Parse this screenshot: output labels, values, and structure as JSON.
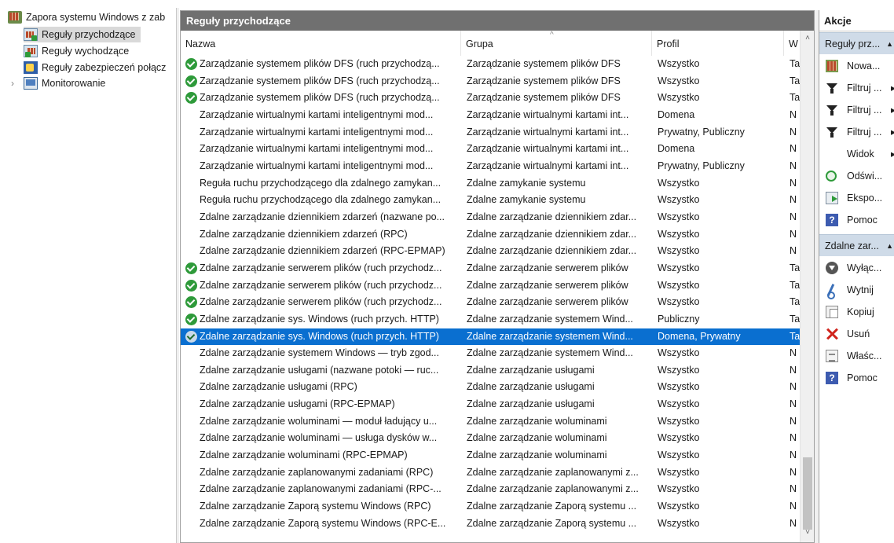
{
  "tree": {
    "root": "Zapora systemu Windows z zab",
    "items": [
      {
        "label": "Reguły przychodzące",
        "selected": true,
        "icon": "inbound-rules-icon"
      },
      {
        "label": "Reguły wychodzące",
        "selected": false,
        "icon": "outbound-rules-icon"
      },
      {
        "label": "Reguły zabezpieczeń połącz",
        "selected": false,
        "icon": "security-rules-icon"
      },
      {
        "label": "Monitorowanie",
        "selected": false,
        "icon": "monitor-icon"
      }
    ],
    "expander": "›"
  },
  "center": {
    "title": "Reguły przychodzące",
    "columns": {
      "name": "Nazwa",
      "group": "Grupa",
      "profile": "Profil",
      "w": "W"
    },
    "sort_glyph": "^",
    "rows": [
      {
        "name": "Zarządzanie systemem plików DFS (ruch przychodzą...",
        "group": "Zarządzanie systemem plików DFS",
        "profile": "Wszystko",
        "w": "Ta",
        "enabled": true,
        "selected": false
      },
      {
        "name": "Zarządzanie systemem plików DFS (ruch przychodzą...",
        "group": "Zarządzanie systemem plików DFS",
        "profile": "Wszystko",
        "w": "Ta",
        "enabled": true,
        "selected": false
      },
      {
        "name": "Zarządzanie systemem plików DFS (ruch przychodzą...",
        "group": "Zarządzanie systemem plików DFS",
        "profile": "Wszystko",
        "w": "Ta",
        "enabled": true,
        "selected": false
      },
      {
        "name": "Zarządzanie wirtualnymi kartami inteligentnymi mod...",
        "group": "Zarządzanie wirtualnymi kartami int...",
        "profile": "Domena",
        "w": "N",
        "enabled": false,
        "selected": false
      },
      {
        "name": "Zarządzanie wirtualnymi kartami inteligentnymi mod...",
        "group": "Zarządzanie wirtualnymi kartami int...",
        "profile": "Prywatny, Publiczny",
        "w": "N",
        "enabled": false,
        "selected": false
      },
      {
        "name": "Zarządzanie wirtualnymi kartami inteligentnymi mod...",
        "group": "Zarządzanie wirtualnymi kartami int...",
        "profile": "Domena",
        "w": "N",
        "enabled": false,
        "selected": false
      },
      {
        "name": "Zarządzanie wirtualnymi kartami inteligentnymi mod...",
        "group": "Zarządzanie wirtualnymi kartami int...",
        "profile": "Prywatny, Publiczny",
        "w": "N",
        "enabled": false,
        "selected": false
      },
      {
        "name": "Reguła ruchu przychodzącego dla zdalnego zamykan...",
        "group": "Zdalne zamykanie systemu",
        "profile": "Wszystko",
        "w": "N",
        "enabled": false,
        "selected": false
      },
      {
        "name": "Reguła ruchu przychodzącego dla zdalnego zamykan...",
        "group": "Zdalne zamykanie systemu",
        "profile": "Wszystko",
        "w": "N",
        "enabled": false,
        "selected": false
      },
      {
        "name": "Zdalne zarządzanie dziennikiem zdarzeń (nazwane po...",
        "group": "Zdalne zarządzanie dziennikiem zdar...",
        "profile": "Wszystko",
        "w": "N",
        "enabled": false,
        "selected": false
      },
      {
        "name": "Zdalne zarządzanie dziennikiem zdarzeń (RPC)",
        "group": "Zdalne zarządzanie dziennikiem zdar...",
        "profile": "Wszystko",
        "w": "N",
        "enabled": false,
        "selected": false
      },
      {
        "name": "Zdalne zarządzanie dziennikiem zdarzeń (RPC-EPMAP)",
        "group": "Zdalne zarządzanie dziennikiem zdar...",
        "profile": "Wszystko",
        "w": "N",
        "enabled": false,
        "selected": false
      },
      {
        "name": "Zdalne zarządzanie serwerem plików (ruch przychodz...",
        "group": "Zdalne zarządzanie serwerem plików",
        "profile": "Wszystko",
        "w": "Ta",
        "enabled": true,
        "selected": false
      },
      {
        "name": "Zdalne zarządzanie serwerem plików (ruch przychodz...",
        "group": "Zdalne zarządzanie serwerem plików",
        "profile": "Wszystko",
        "w": "Ta",
        "enabled": true,
        "selected": false
      },
      {
        "name": "Zdalne zarządzanie serwerem plików (ruch przychodz...",
        "group": "Zdalne zarządzanie serwerem plików",
        "profile": "Wszystko",
        "w": "Ta",
        "enabled": true,
        "selected": false
      },
      {
        "name": "Zdalne zarządzanie sys. Windows (ruch przych. HTTP)",
        "group": "Zdalne zarządzanie systemem Wind...",
        "profile": "Publiczny",
        "w": "Ta",
        "enabled": true,
        "selected": false
      },
      {
        "name": "Zdalne zarządzanie sys. Windows (ruch przych. HTTP)",
        "group": "Zdalne zarządzanie systemem Wind...",
        "profile": "Domena, Prywatny",
        "w": "Ta",
        "enabled": true,
        "selected": true
      },
      {
        "name": "Zdalne zarządzanie systemem Windows — tryb zgod...",
        "group": "Zdalne zarządzanie systemem Wind...",
        "profile": "Wszystko",
        "w": "N",
        "enabled": false,
        "selected": false
      },
      {
        "name": "Zdalne zarządzanie usługami (nazwane potoki — ruc...",
        "group": "Zdalne zarządzanie usługami",
        "profile": "Wszystko",
        "w": "N",
        "enabled": false,
        "selected": false
      },
      {
        "name": "Zdalne zarządzanie usługami (RPC)",
        "group": "Zdalne zarządzanie usługami",
        "profile": "Wszystko",
        "w": "N",
        "enabled": false,
        "selected": false
      },
      {
        "name": "Zdalne zarządzanie usługami (RPC-EPMAP)",
        "group": "Zdalne zarządzanie usługami",
        "profile": "Wszystko",
        "w": "N",
        "enabled": false,
        "selected": false
      },
      {
        "name": "Zdalne zarządzanie woluminami — moduł ładujący u...",
        "group": "Zdalne zarządzanie woluminami",
        "profile": "Wszystko",
        "w": "N",
        "enabled": false,
        "selected": false
      },
      {
        "name": "Zdalne zarządzanie woluminami — usługa dysków w...",
        "group": "Zdalne zarządzanie woluminami",
        "profile": "Wszystko",
        "w": "N",
        "enabled": false,
        "selected": false
      },
      {
        "name": "Zdalne zarządzanie woluminami (RPC-EPMAP)",
        "group": "Zdalne zarządzanie woluminami",
        "profile": "Wszystko",
        "w": "N",
        "enabled": false,
        "selected": false
      },
      {
        "name": "Zdalne zarządzanie zaplanowanymi zadaniami (RPC)",
        "group": "Zdalne zarządzanie zaplanowanymi z...",
        "profile": "Wszystko",
        "w": "N",
        "enabled": false,
        "selected": false
      },
      {
        "name": "Zdalne zarządzanie zaplanowanymi zadaniami (RPC-...",
        "group": "Zdalne zarządzanie zaplanowanymi z...",
        "profile": "Wszystko",
        "w": "N",
        "enabled": false,
        "selected": false
      },
      {
        "name": "Zdalne zarządzanie Zaporą systemu Windows (RPC)",
        "group": "Zdalne zarządzanie Zaporą systemu ...",
        "profile": "Wszystko",
        "w": "N",
        "enabled": false,
        "selected": false
      },
      {
        "name": "Zdalne zarządzanie Zaporą systemu Windows (RPC-E...",
        "group": "Zdalne zarządzanie Zaporą systemu ...",
        "profile": "Wszystko",
        "w": "N",
        "enabled": false,
        "selected": false
      }
    ],
    "scroll_up": "˄",
    "scroll_down": "˅"
  },
  "actions": {
    "title": "Akcje",
    "sections": [
      {
        "label": "Reguły prz...",
        "items": [
          {
            "label": "Nowa...",
            "icon": "new-rule-icon",
            "more": ""
          },
          {
            "label": "Filtruj ...",
            "icon": "filter-icon",
            "more": "▸"
          },
          {
            "label": "Filtruj ...",
            "icon": "filter-icon",
            "more": "▸"
          },
          {
            "label": "Filtruj ...",
            "icon": "filter-icon",
            "more": "▸"
          },
          {
            "label": "Widok",
            "icon": "",
            "more": "▸"
          },
          {
            "label": "Odświ...",
            "icon": "refresh-icon",
            "more": ""
          },
          {
            "label": "Ekspo...",
            "icon": "export-icon",
            "more": ""
          },
          {
            "label": "Pomoc",
            "icon": "help-icon",
            "more": ""
          }
        ]
      },
      {
        "label": "Zdalne zar...",
        "items": [
          {
            "label": "Wyłąc...",
            "icon": "disable-rule-icon",
            "more": ""
          },
          {
            "label": "Wytnij",
            "icon": "cut-icon",
            "more": ""
          },
          {
            "label": "Kopiuj",
            "icon": "copy-icon",
            "more": ""
          },
          {
            "label": "Usuń",
            "icon": "delete-icon",
            "more": ""
          },
          {
            "label": "Właśc...",
            "icon": "properties-icon",
            "more": ""
          },
          {
            "label": "Pomoc",
            "icon": "help-icon",
            "more": ""
          }
        ]
      }
    ],
    "collapse_glyph": "▲"
  }
}
